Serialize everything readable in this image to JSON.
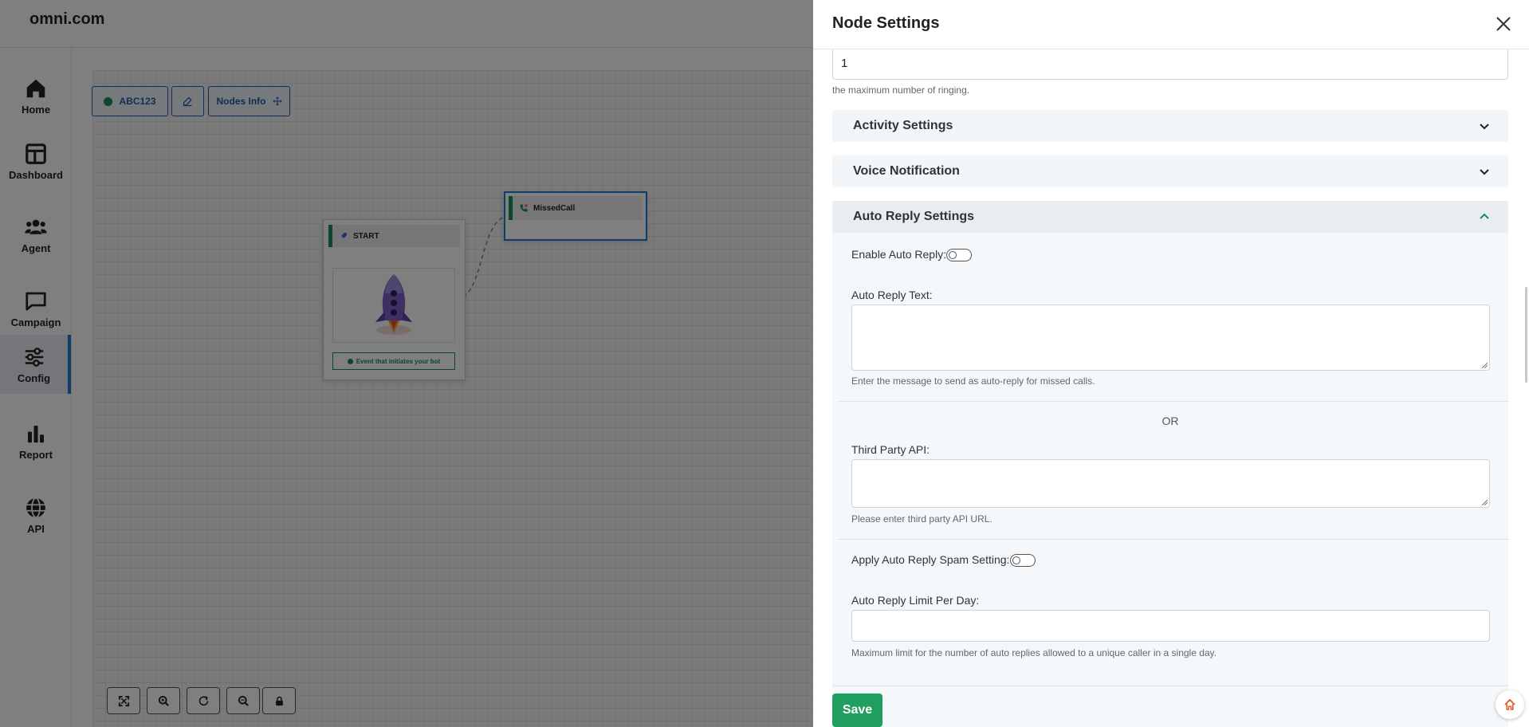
{
  "app": {
    "logo": "omni.com",
    "nav": [
      {
        "label": "Home",
        "icon": "home-icon"
      },
      {
        "label": "Dashboard",
        "icon": "dashboard-icon"
      },
      {
        "label": "Agent",
        "icon": "users-icon"
      },
      {
        "label": "Campaign",
        "icon": "chat-icon"
      },
      {
        "label": "Config",
        "icon": "sliders-icon",
        "active": true
      },
      {
        "label": "Report",
        "icon": "bar-chart-icon"
      },
      {
        "label": "API",
        "icon": "globe-icon"
      }
    ],
    "toolbar": {
      "flow_name": "ABC123",
      "nodes_info": "Nodes Info"
    },
    "nodes": {
      "start": {
        "title": "START",
        "footer": "Event that initiates your bot"
      },
      "missed": {
        "title": "MissedCall"
      }
    },
    "zoom_controls": [
      "fit-view-icon",
      "zoom-in-icon",
      "refresh-icon",
      "zoom-out-icon",
      "lock-icon"
    ]
  },
  "drawer": {
    "title": "Node Settings",
    "ring_count": {
      "value": "1",
      "help": "the maximum number of ringing."
    },
    "sections": {
      "activity": "Activity Settings",
      "voice": "Voice Notification",
      "auto_reply": "Auto Reply Settings"
    },
    "auto_reply": {
      "enable_label": "Enable Auto Reply:",
      "enabled": false,
      "text_label": "Auto Reply Text:",
      "text_value": "",
      "text_help": "Enter the message to send as auto-reply for missed calls.",
      "or_text": "OR",
      "api_label": "Third Party API:",
      "api_value": "",
      "api_help": "Please enter third party API URL.",
      "spam_label": "Apply Auto Reply Spam Setting:",
      "spam_enabled": false,
      "limit_label": "Auto Reply Limit Per Day:",
      "limit_value": "",
      "limit_help": "Maximum limit for the number of auto replies allowed to a unique caller in a single day."
    },
    "save_label": "Save"
  },
  "colors": {
    "accent_green": "#1f9e5f",
    "accent_blue": "#1f78d1",
    "overlay": "rgba(0,0,0,0.5)"
  }
}
